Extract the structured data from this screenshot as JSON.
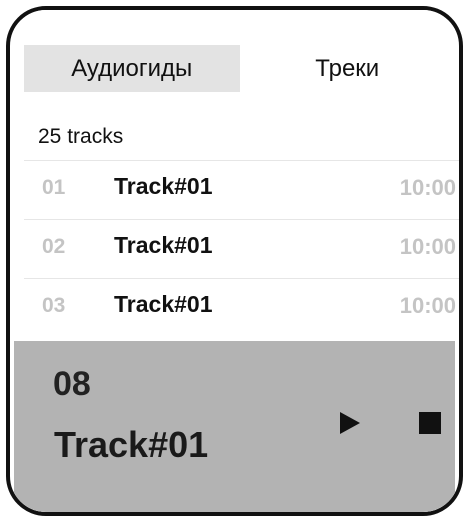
{
  "tabs": [
    {
      "label": "Аудиогиды",
      "active": true
    },
    {
      "label": "Треки",
      "active": false
    }
  ],
  "track_count": "25 tracks",
  "tracks": [
    {
      "num": "01",
      "title": "Track#01",
      "duration": "10:00"
    },
    {
      "num": "02",
      "title": "Track#01",
      "duration": "10:00"
    },
    {
      "num": "03",
      "title": "Track#01",
      "duration": "10:00"
    }
  ],
  "player": {
    "num": "08",
    "title": "Track#01",
    "play_icon": "play-icon",
    "stop_icon": "stop-icon"
  },
  "colors": {
    "active_tab_bg": "#e3e3e3",
    "player_bg": "#b3b3b3",
    "muted_text": "#c4c4c4"
  }
}
